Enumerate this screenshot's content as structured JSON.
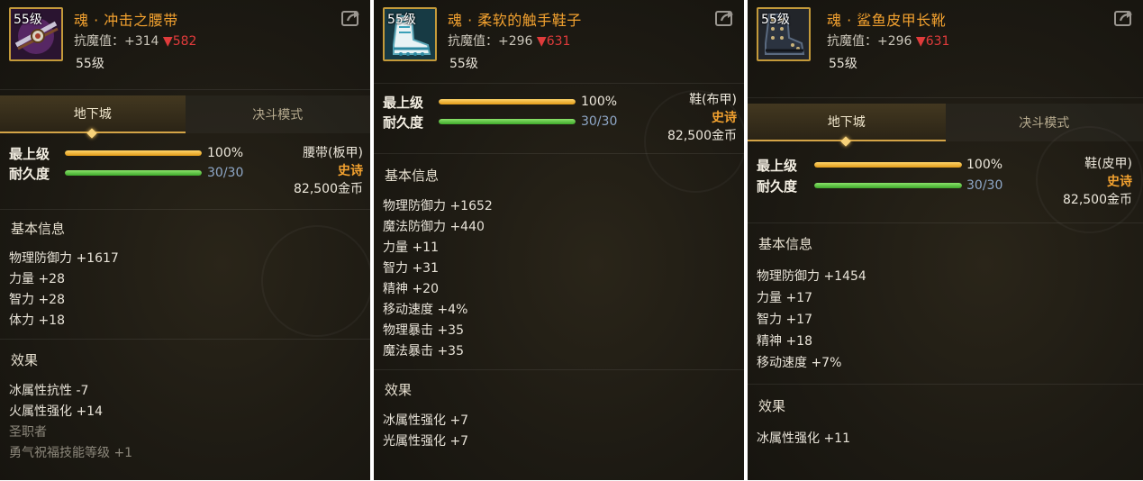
{
  "panels": [
    {
      "item": {
        "level_badge": "55级",
        "name": "魂 · 冲击之腰带",
        "resist_label": "抗魔值：+314",
        "resist_down": "582",
        "required_level": "55级",
        "icon": "belt-icon"
      },
      "tabs": {
        "dungeon": "地下城",
        "duel": "决斗模式"
      },
      "stats": {
        "max_level_label": "最上级",
        "max_level_value": "100%",
        "max_level_fraction": 1.0,
        "durability_label": "耐久度",
        "durability_value": "30/30",
        "durability_fraction": 1.0
      },
      "right": {
        "type": "腰带(板甲)",
        "rarity": "史诗",
        "price": "82,500金币"
      },
      "basic_info_title": "基本信息",
      "basic_info": [
        "物理防御力 +1617",
        "力量 +28",
        "智力 +28",
        "体力 +18"
      ],
      "effects_title": "效果",
      "effects": [
        "冰属性抗性 -7",
        "火属性强化 +14"
      ],
      "effects_grey": [
        "圣职者",
        "勇气祝福技能等级 +1"
      ]
    },
    {
      "item": {
        "level_badge": "55级",
        "name": "魂 · 柔软的触手鞋子",
        "resist_label": "抗魔值：+296",
        "resist_down": "631",
        "required_level": "55级",
        "icon": "shoes-icon"
      },
      "stats": {
        "max_level_label": "最上级",
        "max_level_value": "100%",
        "max_level_fraction": 1.0,
        "durability_label": "耐久度",
        "durability_value": "30/30",
        "durability_fraction": 1.0
      },
      "right": {
        "type": "鞋(布甲)",
        "rarity": "史诗",
        "price": "82,500金币"
      },
      "basic_info_title": "基本信息",
      "basic_info": [
        "物理防御力 +1652",
        "魔法防御力 +440",
        "力量 +11",
        "智力 +31",
        "精神 +20",
        "移动速度 +4%",
        "物理暴击 +35",
        "魔法暴击 +35"
      ],
      "effects_title": "效果",
      "effects": [
        "冰属性强化 +7",
        "光属性强化 +7"
      ]
    },
    {
      "item": {
        "level_badge": "55级",
        "name": "魂 · 鲨鱼皮甲长靴",
        "resist_label": "抗魔值：+296",
        "resist_down": "631",
        "required_level": "55级",
        "icon": "boots-icon"
      },
      "tabs": {
        "dungeon": "地下城",
        "duel": "决斗模式"
      },
      "stats": {
        "max_level_label": "最上级",
        "max_level_value": "100%",
        "max_level_fraction": 1.0,
        "durability_label": "耐久度",
        "durability_value": "30/30",
        "durability_fraction": 1.0
      },
      "right": {
        "type": "鞋(皮甲)",
        "rarity": "史诗",
        "price": "82,500金币"
      },
      "basic_info_title": "基本信息",
      "basic_info": [
        "物理防御力 +1454",
        "力量 +17",
        "智力 +17",
        "精神 +18",
        "移动速度 +7%"
      ],
      "effects_title": "效果",
      "effects": [
        "冰属性强化 +11"
      ]
    }
  ],
  "colors": {
    "item_name": "#f2a12f",
    "rarity_epic": "#f2a12f",
    "resist_down": "#e03b3b",
    "durability_value": "#8fa8c8"
  }
}
